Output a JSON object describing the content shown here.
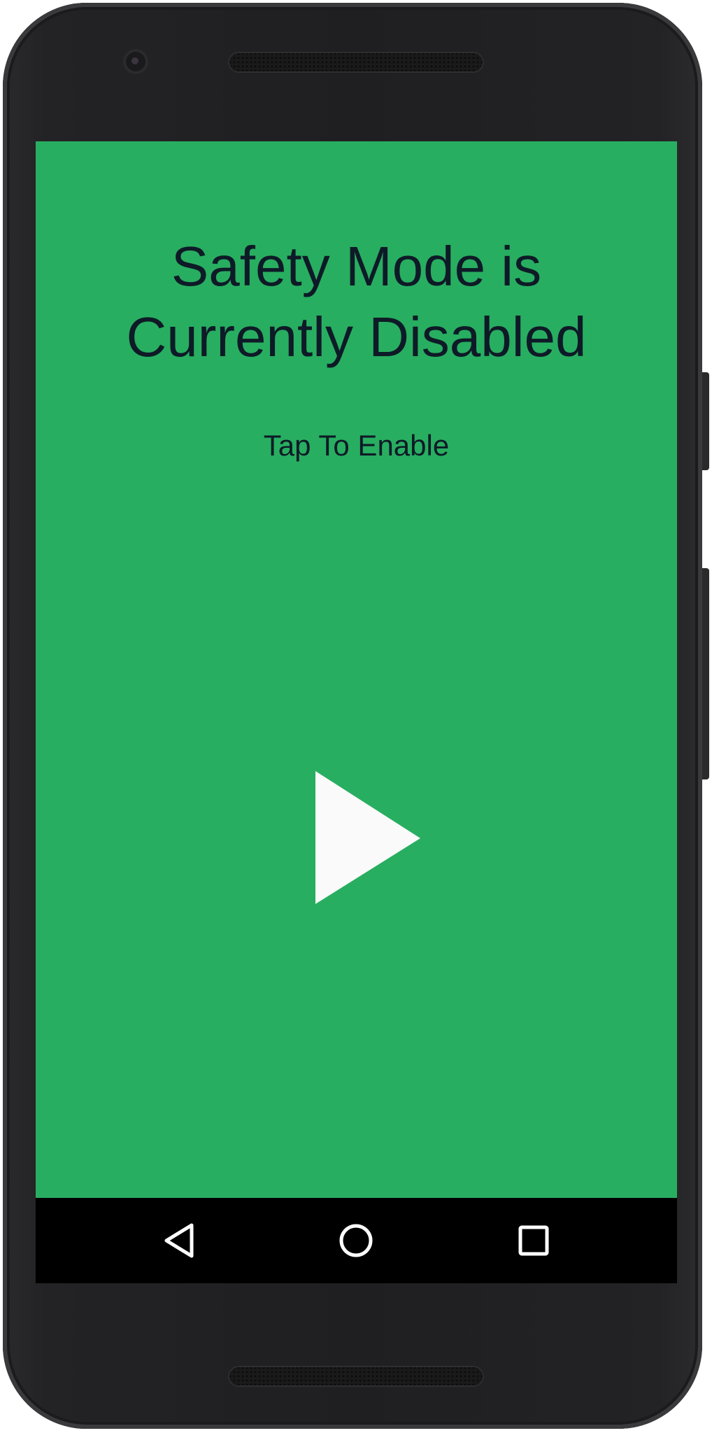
{
  "screen": {
    "headline_line1": "Safety Mode is",
    "headline_line2": "Currently Disabled",
    "subtitle": "Tap To Enable",
    "background_color": "#28ae60",
    "text_color": "#0e1a27",
    "play_icon": "play-icon"
  },
  "navbar": {
    "back_icon": "back-icon",
    "home_icon": "home-icon",
    "recents_icon": "recents-icon"
  }
}
